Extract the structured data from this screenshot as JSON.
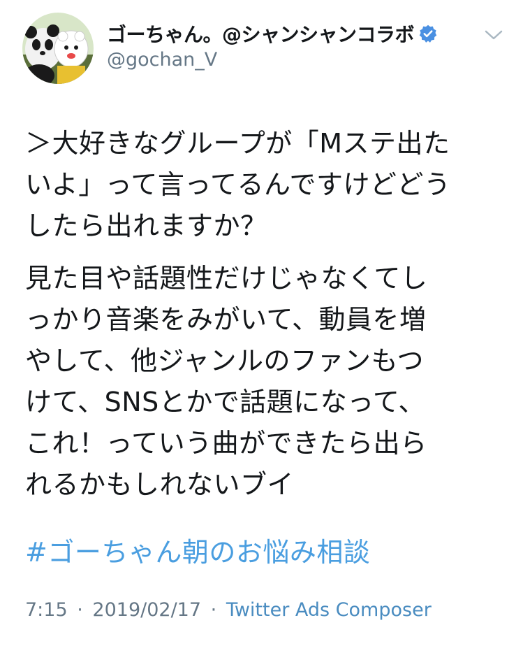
{
  "user": {
    "display_name": "ゴーちゃん。@シャンシャンコラボ",
    "handle": "@gochan_V",
    "verified": true
  },
  "tweet": {
    "para1_lines": [
      "＞大好きなグループが「Mステ出た",
      "いよ」って言ってるんですけどどう",
      "したら出れますか？"
    ],
    "para2_lines": [
      "見た目や話題性だけじゃなくてし",
      "っかり音楽をみがいて、動員を増",
      "やして、他ジャンルのファンもつ",
      "けて、SNSとかで話題になって、",
      "これ！っていう曲ができたら出ら",
      "れるかもしれないブイ"
    ],
    "hashtag": "#ゴーちゃん朝のお悩み相談"
  },
  "meta": {
    "time": "7:15",
    "separator": "·",
    "date": "2019/02/17",
    "source": "Twitter Ads Composer"
  },
  "icons": {
    "avatar": "avatar-icon",
    "verified": "verified-badge-icon",
    "caret": "chevron-down-icon"
  },
  "colors": {
    "hashtag": "#4a9ee0",
    "verified": "#4a90e2",
    "secondary": "#657786"
  }
}
